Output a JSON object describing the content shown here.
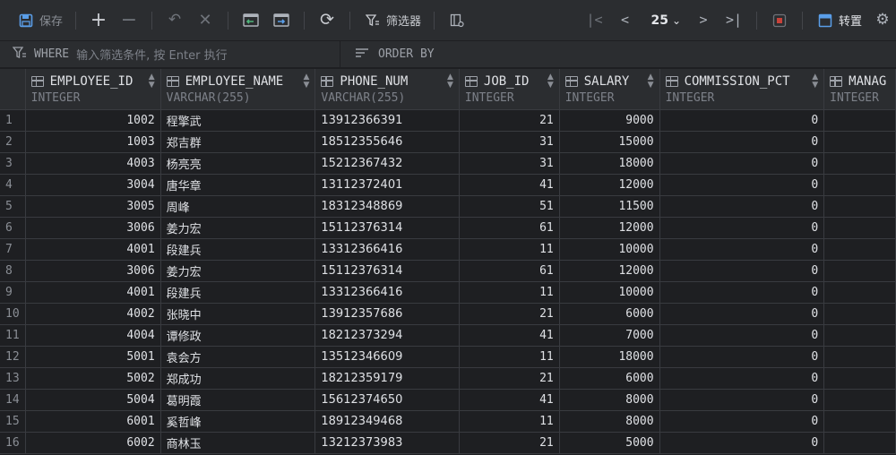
{
  "toolbar": {
    "save_label": "保存",
    "filter_label": "筛选器",
    "page_size": "25",
    "transpose_label": "转置"
  },
  "filter": {
    "where_keyword": "WHERE",
    "where_placeholder": "输入筛选条件, 按 Enter 执行",
    "order_keyword": "ORDER BY"
  },
  "columns": [
    {
      "name": "EMPLOYEE_ID",
      "type": "INTEGER"
    },
    {
      "name": "EMPLOYEE_NAME",
      "type": "VARCHAR(255)"
    },
    {
      "name": "PHONE_NUM",
      "type": "VARCHAR(255)"
    },
    {
      "name": "JOB_ID",
      "type": "INTEGER"
    },
    {
      "name": "SALARY",
      "type": "INTEGER"
    },
    {
      "name": "COMMISSION_PCT",
      "type": "INTEGER"
    },
    {
      "name": "MANAG",
      "type": "INTEGER"
    }
  ],
  "rows": [
    {
      "rn": "1",
      "id": "1002",
      "name": "程擎武",
      "phone": "13912366391",
      "job": "21",
      "salary": "9000",
      "comm": "0"
    },
    {
      "rn": "2",
      "id": "1003",
      "name": "郑吉群",
      "phone": "18512355646",
      "job": "31",
      "salary": "15000",
      "comm": "0"
    },
    {
      "rn": "3",
      "id": "4003",
      "name": "杨亮亮",
      "phone": "15212367432",
      "job": "31",
      "salary": "18000",
      "comm": "0"
    },
    {
      "rn": "4",
      "id": "3004",
      "name": "唐华章",
      "phone": "13112372401",
      "job": "41",
      "salary": "12000",
      "comm": "0"
    },
    {
      "rn": "5",
      "id": "3005",
      "name": "周峰",
      "phone": "18312348869",
      "job": "51",
      "salary": "11500",
      "comm": "0"
    },
    {
      "rn": "6",
      "id": "3006",
      "name": "姜力宏",
      "phone": "15112376314",
      "job": "61",
      "salary": "12000",
      "comm": "0"
    },
    {
      "rn": "7",
      "id": "4001",
      "name": "段建兵",
      "phone": "13312366416",
      "job": "11",
      "salary": "10000",
      "comm": "0"
    },
    {
      "rn": "8",
      "id": "3006",
      "name": "姜力宏",
      "phone": "15112376314",
      "job": "61",
      "salary": "12000",
      "comm": "0"
    },
    {
      "rn": "9",
      "id": "4001",
      "name": "段建兵",
      "phone": "13312366416",
      "job": "11",
      "salary": "10000",
      "comm": "0"
    },
    {
      "rn": "10",
      "id": "4002",
      "name": "张晓中",
      "phone": "13912357686",
      "job": "21",
      "salary": "6000",
      "comm": "0"
    },
    {
      "rn": "11",
      "id": "4004",
      "name": "谭修政",
      "phone": "18212373294",
      "job": "41",
      "salary": "7000",
      "comm": "0"
    },
    {
      "rn": "12",
      "id": "5001",
      "name": "袁会方",
      "phone": "13512346609",
      "job": "11",
      "salary": "18000",
      "comm": "0"
    },
    {
      "rn": "13",
      "id": "5002",
      "name": "郑成功",
      "phone": "18212359179",
      "job": "21",
      "salary": "6000",
      "comm": "0"
    },
    {
      "rn": "14",
      "id": "5004",
      "name": "葛明霞",
      "phone": "15612374650",
      "job": "41",
      "salary": "8000",
      "comm": "0"
    },
    {
      "rn": "15",
      "id": "6001",
      "name": "奚哲峰",
      "phone": "18912349468",
      "job": "11",
      "salary": "8000",
      "comm": "0"
    },
    {
      "rn": "16",
      "id": "6002",
      "name": "商林玉",
      "phone": "13212373983",
      "job": "21",
      "salary": "5000",
      "comm": "0"
    }
  ]
}
